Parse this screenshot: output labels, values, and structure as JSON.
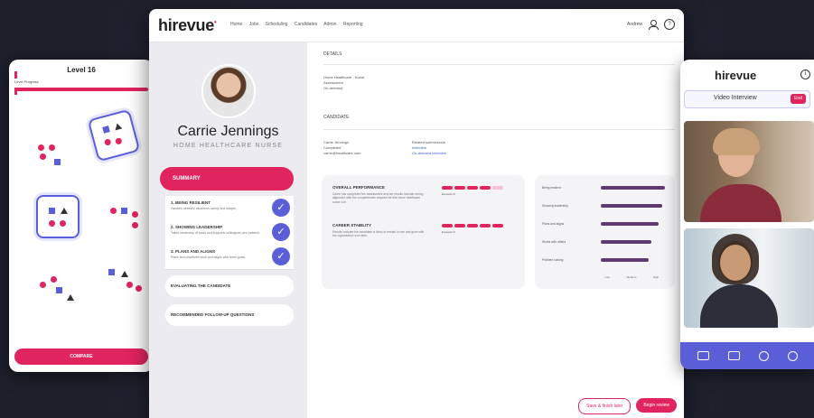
{
  "game": {
    "level": "Level 16",
    "progress_label": "Level Progress",
    "compare_label": "COMPARE",
    "accent": "#e0245e"
  },
  "header": {
    "logo": "hirevue",
    "nav": [
      "Home",
      "Jobs",
      "Scheduling",
      "Candidates",
      "Admin",
      "Reporting"
    ],
    "user": "Andrew"
  },
  "candidate": {
    "name": "Carrie Jennings",
    "role": "HOME HEALTHCARE NURSE"
  },
  "sidebar": {
    "summary": "SUMMARY",
    "competencies": [
      {
        "title": "1. BEING RESILIENT",
        "desc": "Handles stressful situations calmly and adapts."
      },
      {
        "title": "2. SHOWING LEADERSHIP",
        "desc": "Takes ownership of tasks and supports colleagues and patients."
      },
      {
        "title": "3. PLANS AND ALIGNS",
        "desc": "Plans and prioritizes work and aligns with team goals."
      }
    ],
    "evaluating": "EVALUATING THE CANDIDATE",
    "followup": "RECOMMENDED FOLLOW-UP QUESTIONS"
  },
  "details": {
    "section": "DETAILS",
    "job": "Home Healthcare - Nurse",
    "line2": "Assessment",
    "line3": "On-demand",
    "candidate_section": "CANDIDATE",
    "cand_name": "Carrie Jennings",
    "cand_l2": "Completed",
    "cand_l3": "carrie@healthcare.com",
    "related_title": "Related submissions",
    "related_l1": "Interview",
    "related_l2": "On-demand interview"
  },
  "performance": {
    "overall_title": "OVERALL PERFORMANCE",
    "overall_desc": "Carrie has completed the assessment and her results indicate strong alignment with the competencies required for this home healthcare nurse role.",
    "overall_level": "Exceeds fit",
    "career_title": "CAREER STABILITY",
    "career_desc": "Results indicate the candidate is likely to remain in role and grow with the organization over time.",
    "career_level": "Exceeds fit"
  },
  "chart_data": {
    "type": "bar",
    "categories": [
      "Being resilient",
      "Showing leadership",
      "Plans and aligns",
      "Works with others",
      "Problem solving"
    ],
    "values": [
      0.95,
      0.9,
      0.85,
      0.75,
      0.7
    ],
    "xlabel": "",
    "ylabel": "",
    "scale_labels": [
      "Low",
      "Medium",
      "High"
    ]
  },
  "actions": {
    "save": "Save & finish later",
    "begin": "Begin review"
  },
  "video": {
    "logo": "hirevue",
    "title": "Video Interview",
    "end": "End"
  }
}
